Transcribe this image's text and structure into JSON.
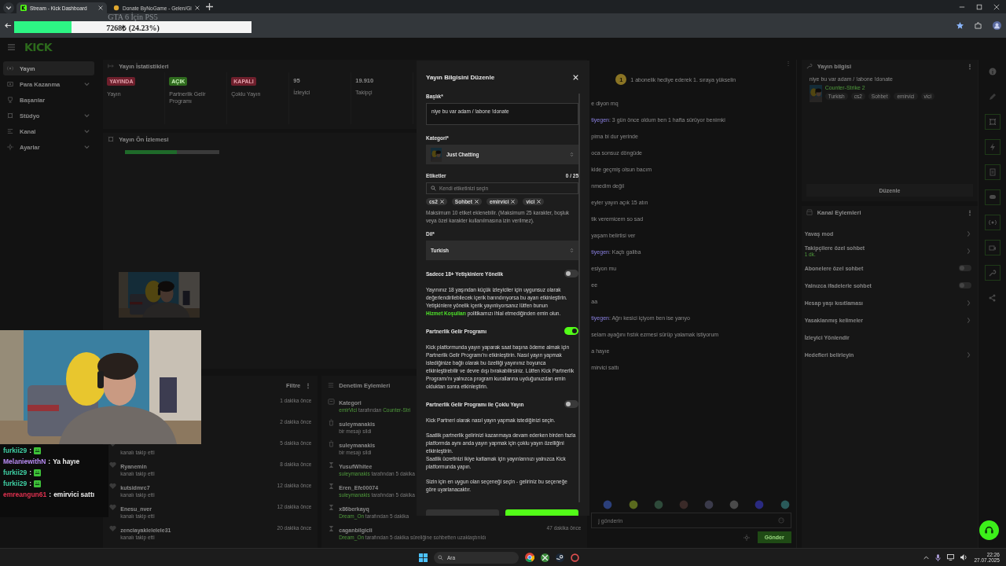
{
  "browser": {
    "tabs": [
      {
        "label": "Stream - Kick Dashboard",
        "selected": true
      },
      {
        "label": "Donate ByNoGame - Gelen/Gi",
        "selected": false
      }
    ]
  },
  "donation": {
    "title": "GTA 6 İçin PS5",
    "level": 0.2423,
    "amount": "7268₺ (24.23%)"
  },
  "header": {
    "logo": "KICK"
  },
  "sidebar": {
    "items": [
      {
        "label": "Yayın",
        "selected": true,
        "expandable": false
      },
      {
        "label": "Para Kazanma",
        "selected": false,
        "expandable": true
      },
      {
        "label": "Başarılar",
        "selected": false,
        "expandable": false
      },
      {
        "label": "Stüdyo",
        "selected": false,
        "expandable": true
      },
      {
        "label": "Kanal",
        "selected": false,
        "expandable": true
      },
      {
        "label": "Ayarlar",
        "selected": false,
        "expandable": true
      }
    ]
  },
  "stats": {
    "title": "Yayın İstatistikleri",
    "items": [
      {
        "kind": "badge",
        "value": "YAYINDA",
        "color": "#6e1f2c",
        "label": "Yayın"
      },
      {
        "kind": "badge",
        "value": "AÇIK",
        "color": "#2f6b1e",
        "label": "Partnerlik Gelir Programı"
      },
      {
        "kind": "badge",
        "value": "KAPALI",
        "color": "#6e1f2c",
        "label": "Çoklu Yayın"
      },
      {
        "kind": "number",
        "value": "95",
        "label": "İzleyici"
      },
      {
        "kind": "number",
        "value": "19.910",
        "label": "Takipçi"
      }
    ]
  },
  "preview": {
    "title": "Yayın Ön İzlemesi",
    "level": 0.55
  },
  "activity": {
    "filter": "Filtre",
    "more": "⋮",
    "rows": [
      {
        "time": "1 dakika önce"
      },
      {
        "time": "2 dakika önce"
      },
      {
        "sub": "kanalı takip etti",
        "time": "5 dakika önce"
      },
      {
        "name": "Ryanemin",
        "sub": "kanalı takip etti",
        "time": "8 dakika önce"
      },
      {
        "name": "kutsidmrc7",
        "sub": "kanalı takip etti",
        "time": "12 dakika önce"
      },
      {
        "name": "Enesu_nver",
        "sub": "kanalı takip etti",
        "time": "12 dakika önce"
      },
      {
        "name": "zenciayaklelelele31",
        "sub": "kanalı takip etti",
        "time": "20 dakika önce"
      }
    ]
  },
  "moderation": {
    "title": "Denetim Eylemleri",
    "rows": [
      {
        "kind": "category",
        "name": "Kategori",
        "actor": "emirVici",
        "sub": " tarafından ",
        "target": "Counter-Stri"
      },
      {
        "kind": "delete",
        "name": "suleymanakis",
        "sub": "bir mesajı sildi"
      },
      {
        "kind": "delete",
        "name": "suleymanakis",
        "sub": "bir mesajı sildi"
      },
      {
        "kind": "timeout",
        "name": "YusufWhitee",
        "actor": "suleymanakis",
        "sub": " tarafından 5 dakika"
      },
      {
        "kind": "timeout",
        "name": "Eren_Efe00074",
        "actor": "suleymanakis",
        "sub": " tarafından 5 dakika"
      },
      {
        "kind": "timeout",
        "name": "x86berkayq",
        "actor": "Dream_On",
        "sub": " tarafından 5 dakika"
      },
      {
        "kind": "timeout",
        "name": "caganbilgicli",
        "actor": "Dream_On",
        "sub": " tarafından 5 dakika süreliğine sohbetten uzaklaştırıldı",
        "time": "47 dakika önce"
      }
    ]
  },
  "chat": {
    "more": "⋮",
    "promo": "1 abonelik hediye ederek 1. sıraya yükselin",
    "coin": "1",
    "messages": [
      {
        "text": "e diyon mq"
      },
      {
        "user": "tiyegen",
        "text": ": 3 gün önce oldum ben 1 hafta sürüyor benimki"
      },
      {
        "text": "pima bi dur yerinde"
      },
      {
        "text": "oca sonsuz döngüde"
      },
      {
        "text": "kide geçmiş olsun bacım"
      },
      {
        "text": "nmedim değil"
      },
      {
        "text": "eyler yayın açık 15 atın"
      },
      {
        "text": "tik veremicem so sad"
      },
      {
        "text": "yaşam belirtisi ver"
      },
      {
        "user": "tiyegen",
        "text": ": Kaçtı galiba"
      },
      {
        "text": "esiyon mu"
      },
      {
        "text": "ee"
      },
      {
        "text": "aa"
      },
      {
        "user": "tiyegen",
        "text": ": Ağrı kesici içiyom ben ise yarıyo"
      },
      {
        "text": " selam ayağını fıstık ezmesi sürüp yalamak istiyorum"
      },
      {
        "text": "a hayıe"
      },
      {
        "text": "mirvici sattı"
      }
    ],
    "input_placeholder": "j gönderin",
    "send": "Gönder"
  },
  "stream_info": {
    "title": "Yayın bilgisi",
    "more": "⋮",
    "stream_title": "niye bu var adam / !abone !donate",
    "category": "Counter-Strike 2",
    "tags": [
      "Turkish",
      "cs2",
      "Sohbet",
      "emirvici",
      "vici"
    ],
    "edit": "Düzenle"
  },
  "channel_actions": {
    "title": "Kanal Eylemleri",
    "more": "⋮",
    "items": [
      {
        "kind": "link",
        "label": "Yavaş mod"
      },
      {
        "kind": "link",
        "label": "Takipçilere özel sohbet",
        "sub": "1 dk."
      },
      {
        "kind": "toggle",
        "label": "Abonelere özel sohbet",
        "on": false
      },
      {
        "kind": "toggle",
        "label": "Yalnızca ifadelerle sohbet",
        "on": false
      },
      {
        "kind": "link",
        "label": "Hesap yaşı kısıtlaması"
      },
      {
        "kind": "link",
        "label": "Yasaklanmış kelimeler"
      },
      {
        "kind": "plain",
        "label": "İzleyici Yönlendir"
      },
      {
        "kind": "link",
        "label": "Hedefleri belirleyin"
      }
    ]
  },
  "modal": {
    "title": "Yayın Bilgisini Düzenle",
    "title_label": "Başlık*",
    "title_value": "niye bu var adam / !abone !donate",
    "category_label": "Kategori*",
    "category": "Just Chatting",
    "tags_label": "Etiketler",
    "tags_count": "0 / 25",
    "tags_placeholder": "Kendi etiketinizi seçin",
    "tags": [
      "cs2",
      "Sohbet",
      "emirvici",
      "vici"
    ],
    "tags_help": "Maksimum 10 etiket eklenebilir. (Maksimum 25 karakter, boşluk veya özel karakter kullanılmasına izin verilmez).",
    "language_label": "Dil*",
    "language": "Turkish",
    "settings": [
      {
        "label": "Sadece 18+ Yetişkinlere Yönelik",
        "on": false,
        "paragraphs": [
          "Yayınınız 18 yaşından küçük izleyiciler için uygunsuz olarak değerlendirilebilecek içerik barındırıyorsa bu ayarı etkinleştirin. Yetişkinlere yönelik içerik yayınlıyorsanız lütfen bunun **Hizmet Koşulları** politikamızı ihlal etmediğinden emin olun."
        ]
      },
      {
        "label": "Partnerlik Gelir Programı",
        "on": true,
        "paragraphs": [
          "Kick platformunda yayın yaparak saat başına ödeme almak için Partnerlik Gelir Programı'nı etkinleştirin. Nasıl yayın yapmak istediğinize bağlı olarak bu özelliği yayınınız boyunca etkinleştirebilir ve devre dışı bırakabilirsiniz. Lütfen Kick Partnerlik Programı'nı yalnızca program kurallarına uyduğunuzdan emin olduktan sonra etkinleştirin."
        ]
      },
      {
        "label": "Partnerlik Gelir Programı ile Çoklu Yayın",
        "on": false,
        "paragraphs": [
          "Kick Partneri olarak nasıl yayın yapmak istediğinizi seçin.",
          "Saatlik partnerlik gelirinizi kazanmaya devam ederken birden fazla platformda aynı anda yayın yapmak için çoklu yayın özelliğini etkinleştirin.\nSaatlik ücretinizi ikiye katlamak için yayınlarınızı yalnızca Kick platformunda yapın.",
          "Sizin için en uygun olan seçeneği seçin - geliriniz bu seçeneğe göre uyarlanacaktır."
        ]
      }
    ]
  },
  "overlay_chat": [
    {
      "user": "furkii29",
      "color": "#3fd0a4",
      "sep": ":",
      "kind": "emote"
    },
    {
      "user": "MelaniewithN",
      "color": "#b98cf5",
      "sep": ":",
      "kind": "text",
      "text": "Ya hayıe"
    },
    {
      "user": "furkii29",
      "color": "#3fd0a4",
      "sep": ":",
      "kind": "emote"
    },
    {
      "user": "furkii29",
      "color": "#3fd0a4",
      "sep": ":",
      "kind": "emote"
    },
    {
      "user": "emreangun61",
      "color": "#e0314f",
      "sep": ":",
      "kind": "text",
      "text": "emirvici sattı"
    }
  ],
  "taskbar": {
    "search": "Ara",
    "time": "22:26",
    "date": "27.07.2025"
  }
}
